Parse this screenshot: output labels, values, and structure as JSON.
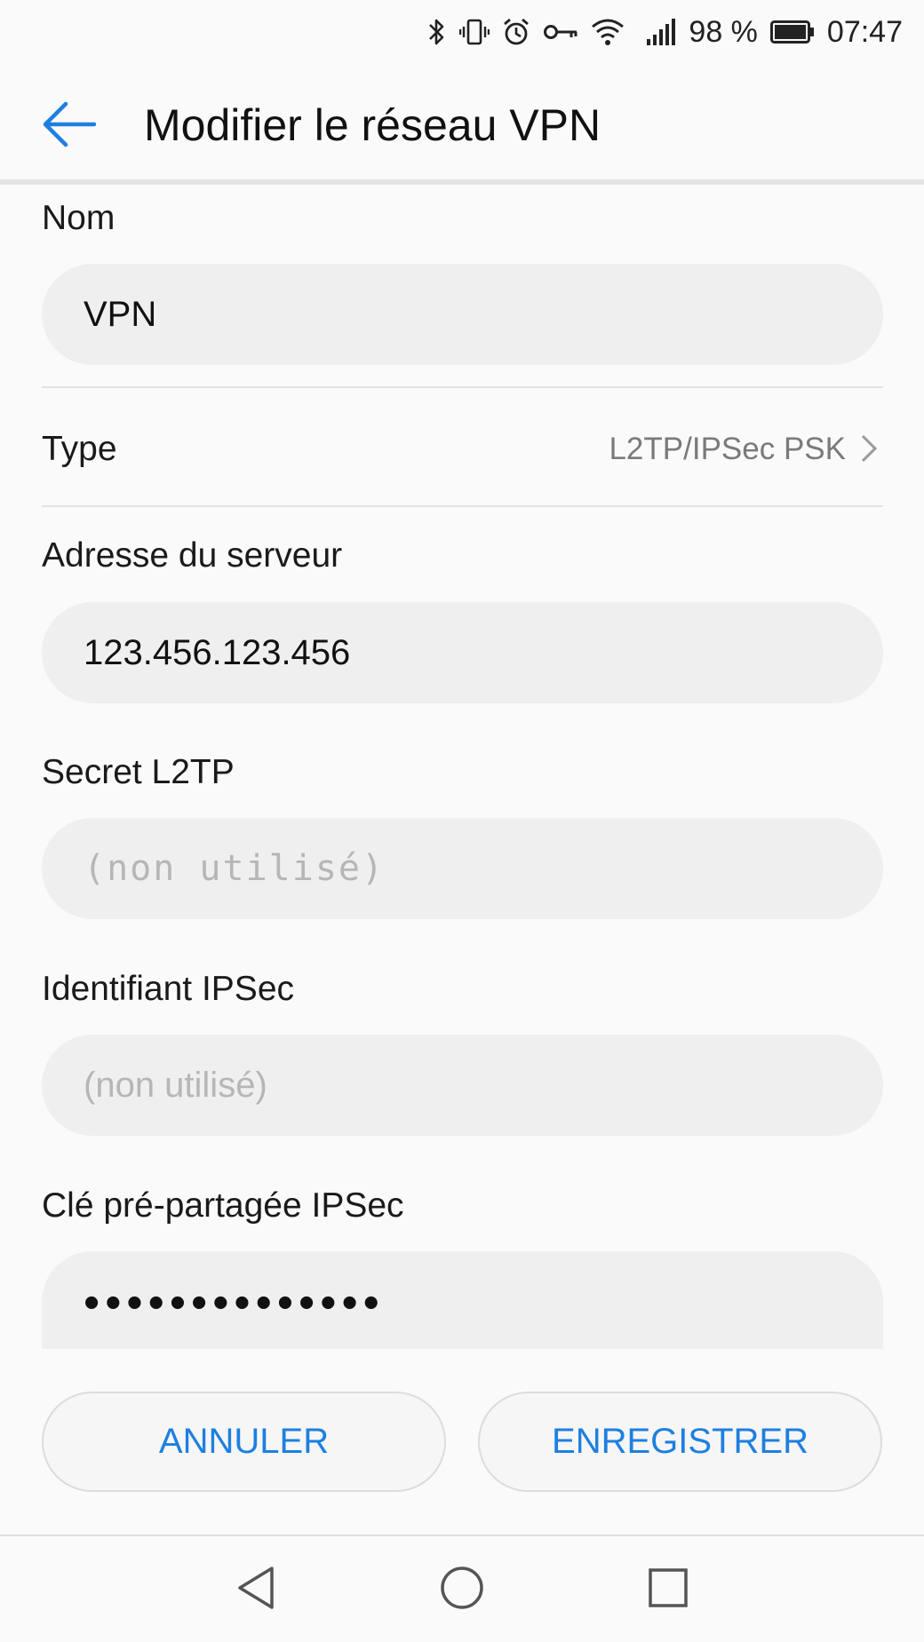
{
  "status_bar": {
    "battery_percent": "98 %",
    "time": "07:47",
    "icons": [
      "bluetooth-icon",
      "vibrate-icon",
      "alarm-icon",
      "vpn-key-icon",
      "wifi-icon",
      "signal-icon",
      "battery-icon"
    ]
  },
  "header": {
    "title": "Modifier le réseau VPN",
    "back_icon": "arrow-back-icon"
  },
  "form": {
    "name": {
      "label": "Nom",
      "value": "VPN"
    },
    "type": {
      "label": "Type",
      "value": "L2TP/IPSec PSK"
    },
    "server": {
      "label": "Adresse du serveur",
      "value": "123.456.123.456"
    },
    "l2tp_secret": {
      "label": "Secret L2TP",
      "placeholder": "(non utilisé)"
    },
    "ipsec_identifier": {
      "label": "Identifiant IPSec",
      "placeholder": "(non utilisé)"
    },
    "ipsec_psk": {
      "label": "Clé pré-partagée IPSec",
      "value": "••••••••••••••"
    }
  },
  "actions": {
    "cancel_label": "ANNULER",
    "save_label": "ENREGISTRER"
  },
  "colors": {
    "accent": "#1e7fe0",
    "background": "#fafafa",
    "field_bg": "#efefef",
    "placeholder": "#b6b6b6"
  }
}
